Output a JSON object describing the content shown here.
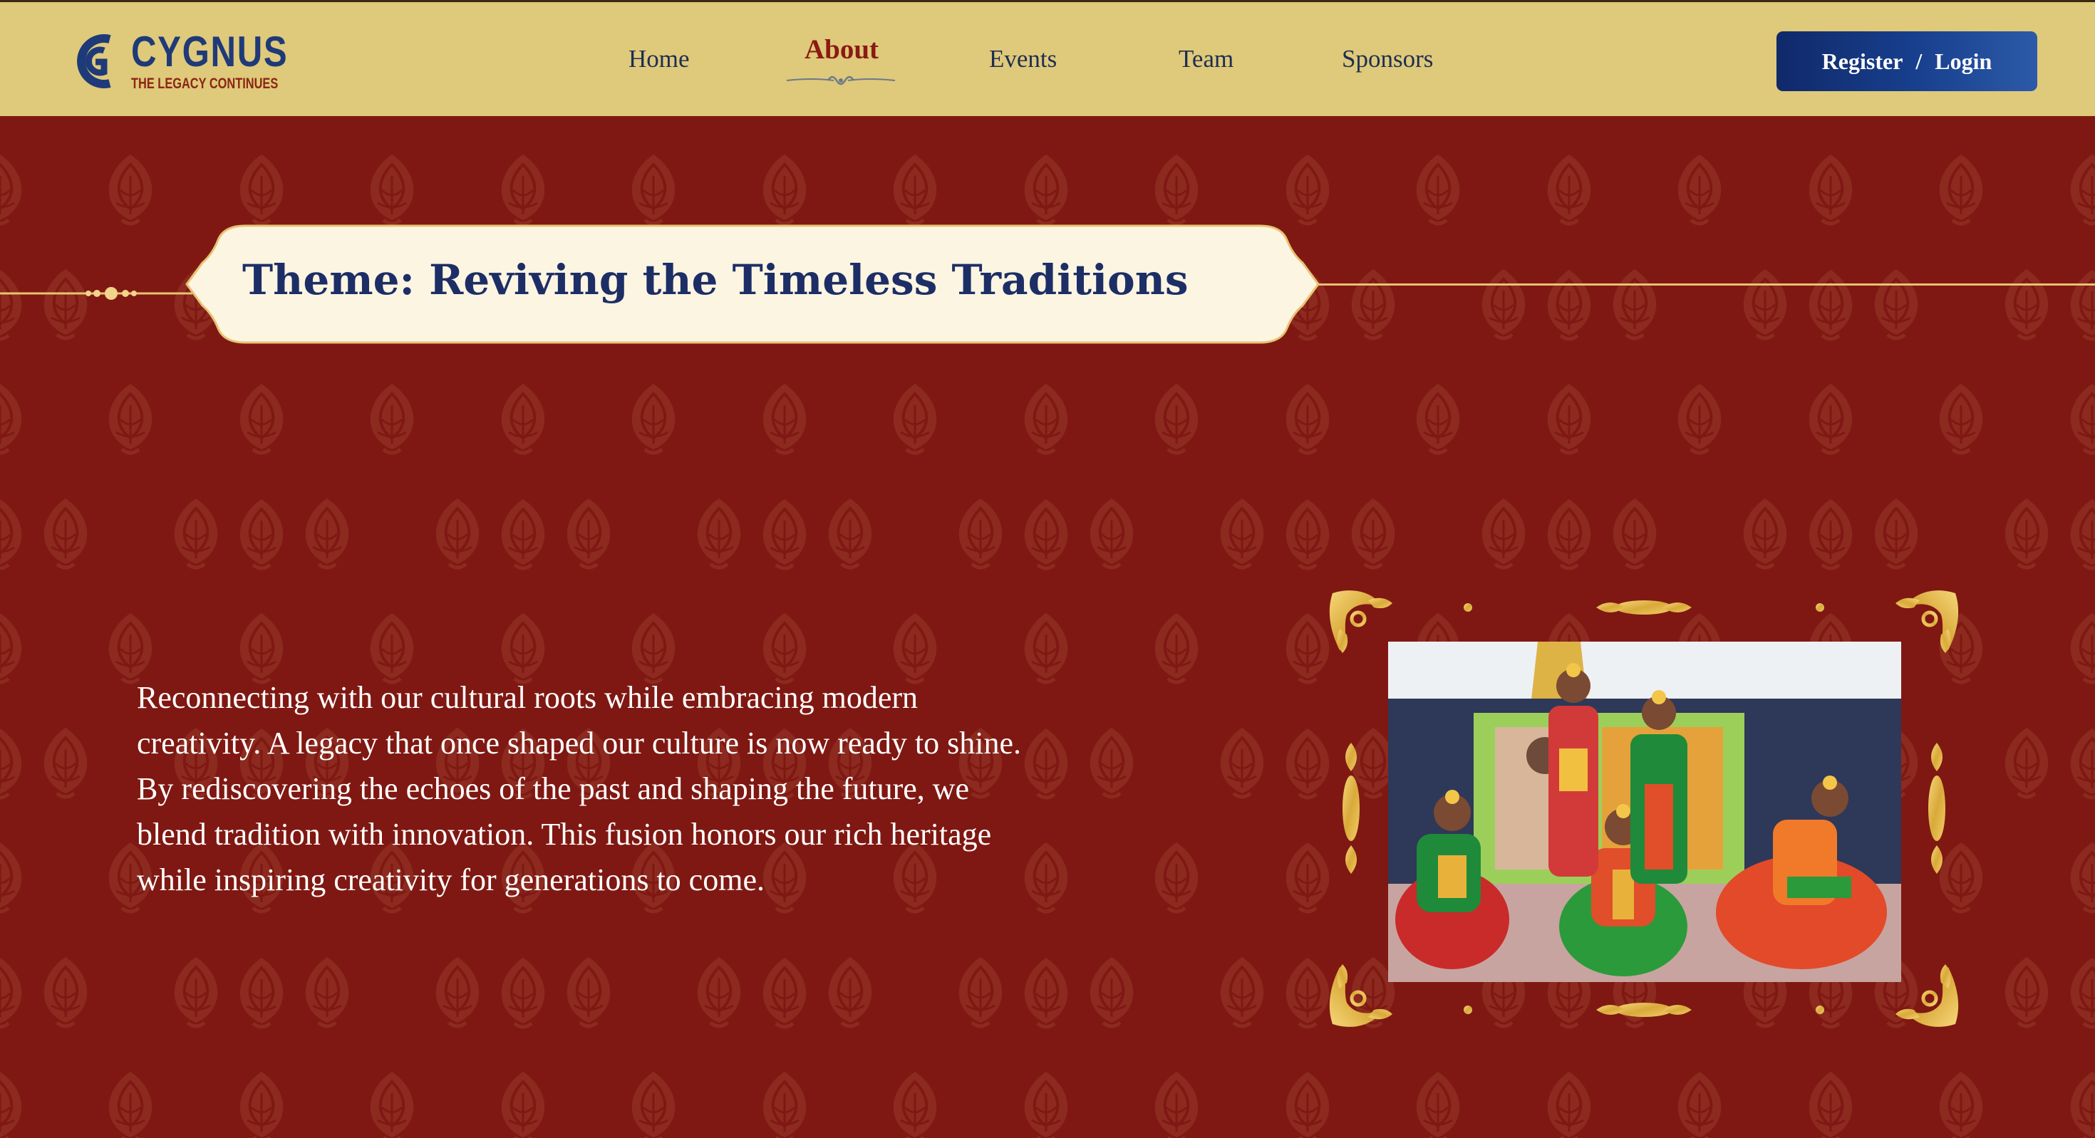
{
  "header": {
    "logo": {
      "title": "CYGNUS",
      "tagline": "THE LEGACY CONTINUES"
    },
    "nav": [
      {
        "label": "Home",
        "active": false
      },
      {
        "label": "About",
        "active": true
      },
      {
        "label": "Events",
        "active": false
      },
      {
        "label": "Team",
        "active": false
      },
      {
        "label": "Sponsors",
        "active": false
      }
    ],
    "auth": {
      "register_label": "Register",
      "separator": "/",
      "login_label": "Login"
    }
  },
  "main": {
    "theme_title": "Theme: Reviving the Timeless Traditions",
    "description": "Reconnecting with our cultural roots while embracing modern creativity. A legacy that once shaped our culture is now ready to shine. By rediscovering the echoes of the past and shaping the future, we blend tradition with innovation. This fusion honors our rich heritage while inspiring creativity for generations to come."
  },
  "colors": {
    "header_bg": "#dfc97a",
    "page_bg": "#7f1812",
    "brand_blue": "#1d2e66",
    "accent_gold": "#e8c272",
    "active_nav": "#8b1a12"
  },
  "icons": [
    "cygnus-logo-icon",
    "ornament-underline-icon",
    "ornament-divider-icon",
    "paisley-pattern",
    "ornate-gold-frame"
  ]
}
